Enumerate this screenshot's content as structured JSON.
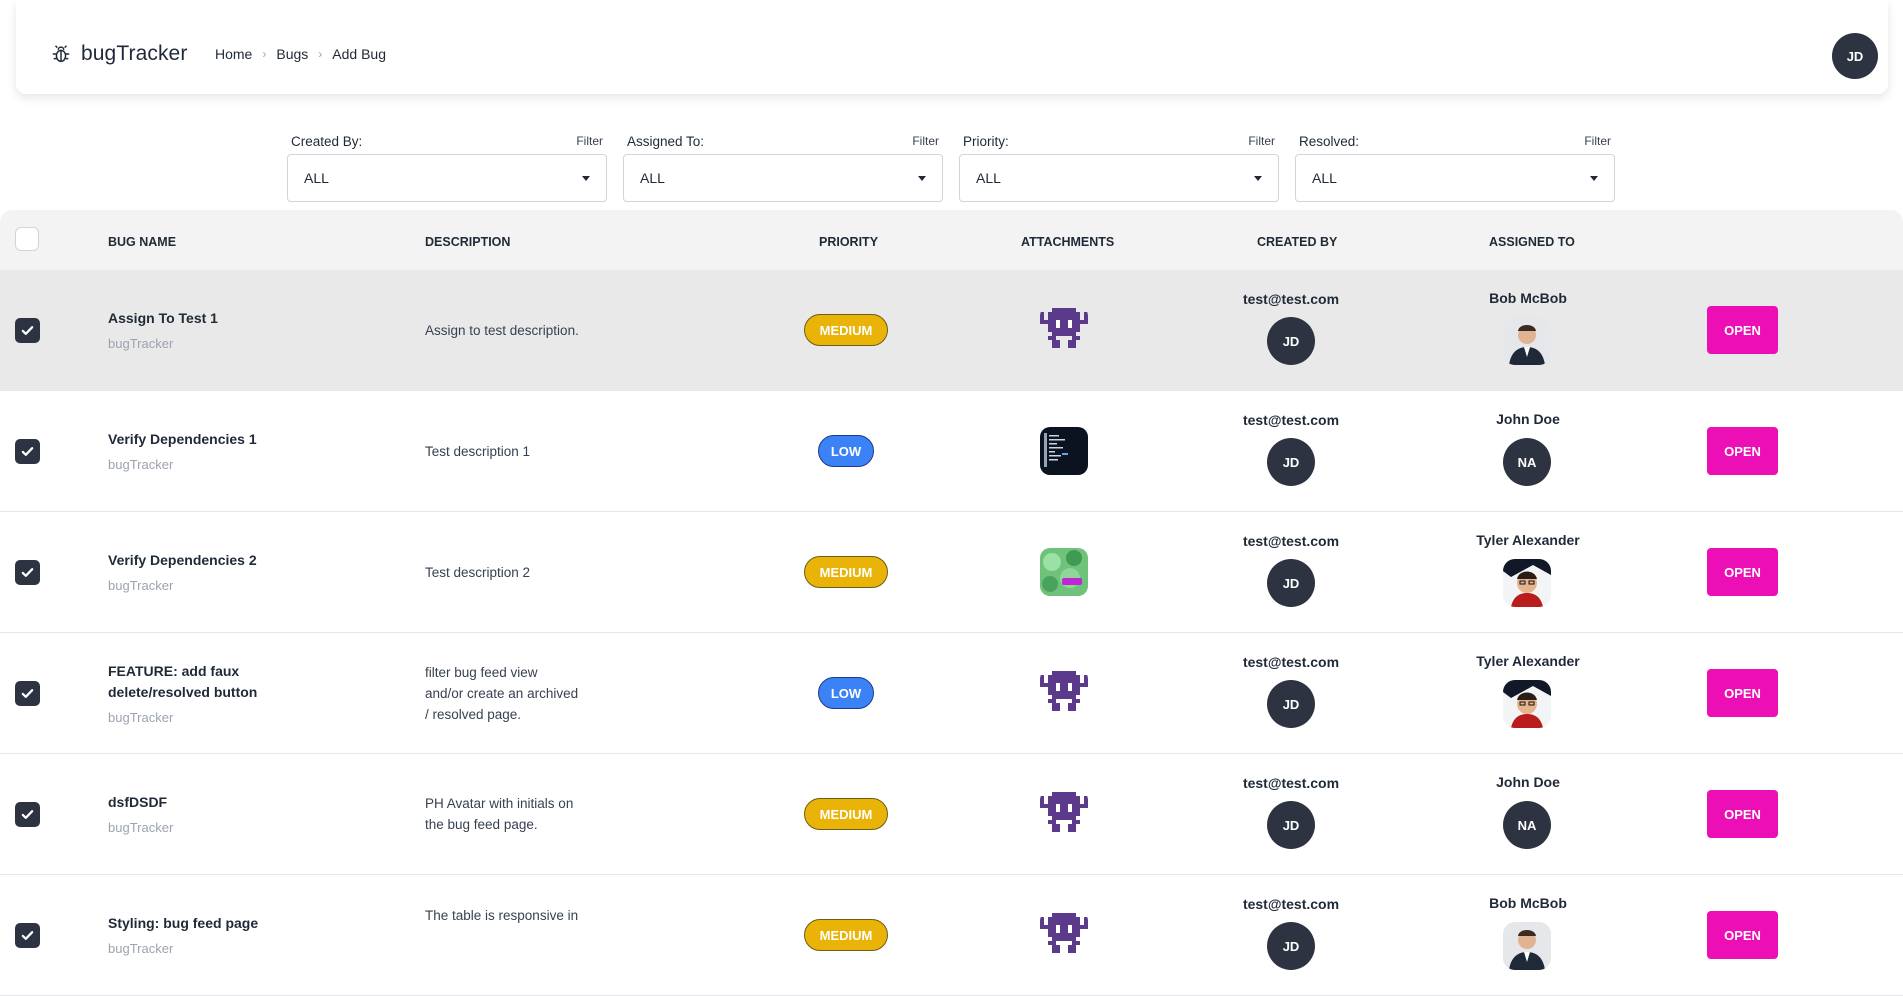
{
  "app": {
    "name": "bugTracker"
  },
  "breadcrumbs": [
    "Home",
    "Bugs",
    "Add Bug"
  ],
  "user": {
    "initials": "JD"
  },
  "filters": [
    {
      "label": "Created By:",
      "action": "Filter",
      "value": "ALL"
    },
    {
      "label": "Assigned To:",
      "action": "Filter",
      "value": "ALL"
    },
    {
      "label": "Priority:",
      "action": "Filter",
      "value": "ALL"
    },
    {
      "label": "Resolved:",
      "action": "Filter",
      "value": "ALL"
    }
  ],
  "table": {
    "columns": [
      "BUG NAME",
      "DESCRIPTION",
      "PRIORITY",
      "ATTACHMENTS",
      "CREATED BY",
      "ASSIGNED TO"
    ],
    "rows": [
      {
        "name": "Assign To Test 1",
        "project": "bugTracker",
        "description": [
          "Assign to test description."
        ],
        "priority": "MEDIUM",
        "attachment": "invader-icon",
        "created_by": "test@test.com",
        "creator_initials": "JD",
        "assigned_to": "Bob McBob",
        "assignee": "photo-man-suit",
        "action": "OPEN",
        "checked": true,
        "selected": true
      },
      {
        "name": "Verify Dependencies 1",
        "project": "bugTracker",
        "description": [
          "Test description 1"
        ],
        "priority": "LOW",
        "attachment": "terminal-screenshot",
        "created_by": "test@test.com",
        "creator_initials": "JD",
        "assigned_to": "John Doe",
        "assignee_initials": "NA",
        "action": "OPEN",
        "checked": true
      },
      {
        "name": "Verify Dependencies 2",
        "project": "bugTracker",
        "description": [
          "Test description 2"
        ],
        "priority": "MEDIUM",
        "attachment": "green-photo",
        "created_by": "test@test.com",
        "creator_initials": "JD",
        "assigned_to": "Tyler Alexander",
        "assignee": "photo-man-glasses",
        "action": "OPEN",
        "checked": true
      },
      {
        "name": "FEATURE: add faux delete/resolved button",
        "project": "bugTracker",
        "description": [
          "filter bug feed view",
          "and/or create an archived",
          "/ resolved page."
        ],
        "priority": "LOW",
        "attachment": "invader-icon",
        "created_by": "test@test.com",
        "creator_initials": "JD",
        "assigned_to": "Tyler Alexander",
        "assignee": "photo-man-glasses",
        "action": "OPEN",
        "checked": true
      },
      {
        "name": "dsfDSDF",
        "project": "bugTracker",
        "description": [
          "PH Avatar with initials on",
          "the bug feed page."
        ],
        "priority": "MEDIUM",
        "attachment": "invader-icon",
        "created_by": "test@test.com",
        "creator_initials": "JD",
        "assigned_to": "John Doe",
        "assignee_initials": "NA",
        "action": "OPEN",
        "checked": true
      },
      {
        "name": "Styling: bug feed page",
        "project": "bugTracker",
        "description": [
          "The table is responsive in"
        ],
        "priority": "MEDIUM",
        "attachment": "invader-icon",
        "created_by": "test@test.com",
        "creator_initials": "JD",
        "assigned_to": "Bob McBob",
        "assignee": "photo-man-suit",
        "action": "OPEN",
        "checked": true
      }
    ]
  },
  "colors": {
    "open_button": "#ec0fb6",
    "medium": "#eab308",
    "low": "#3b82f6",
    "avatar": "#2d3340",
    "invader": "#5b3a8c"
  }
}
